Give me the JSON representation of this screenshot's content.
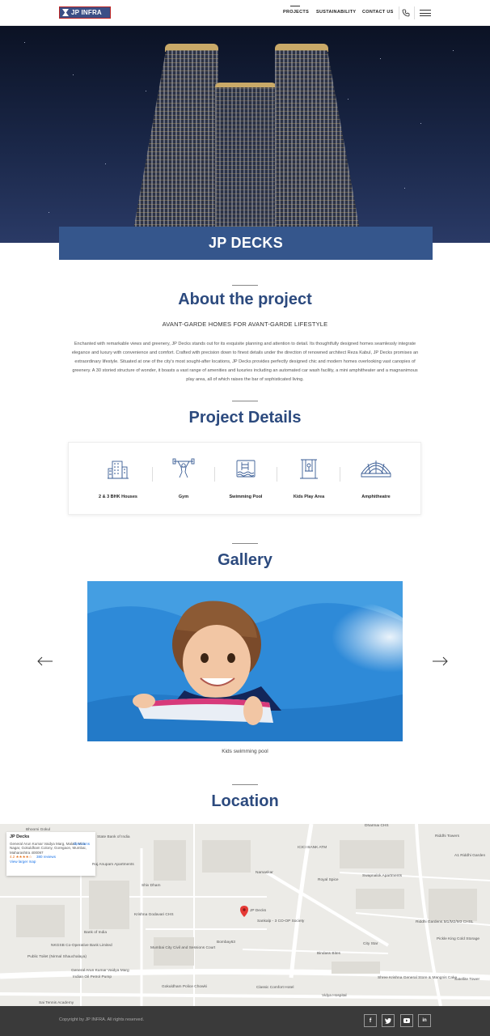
{
  "header": {
    "logo_text": "JP INFRA",
    "nav": [
      "PROJECTS",
      "SUSTAINABILITY",
      "CONTACT US"
    ]
  },
  "hero": {
    "title": "JP DECKS"
  },
  "about": {
    "heading": "About the project",
    "subheading": "AVANT-GARDE HOMES FOR AVANT-GARDE LIFESTYLE",
    "body": "Enchanted with remarkable views and greenery, JP Decks stands out for its exquisite planning and attention to detail. Its thoughtfully designed homes seamlessly integrate elegance and luxury with convenience and comfort. Crafted with precision down to finest details under the direction of renowned architect Reza Kabul, JP Decks promises an extraordinary lifestyle. Situated at one of the city's most sought-after locations, JP Decks provides perfectly designed chic and modern homes overlooking vast canopies of greenery. A 30 storied structure of wonder, it boasts a vast range of amenities and luxuries including an automated car wash facility, a mini amphitheater and a magnanimous play area, all of which raises the bar of sophisticated living."
  },
  "details": {
    "heading": "Project Details",
    "features": [
      {
        "label": "2 & 3 BHK Houses",
        "icon": "building-icon"
      },
      {
        "label": "Gym",
        "icon": "weightlifter-icon"
      },
      {
        "label": "Swimming Pool",
        "icon": "pool-icon"
      },
      {
        "label": "Kids Play Area",
        "icon": "swing-icon"
      },
      {
        "label": "Amphitheatre",
        "icon": "amphitheatre-icon"
      }
    ]
  },
  "gallery": {
    "heading": "Gallery",
    "caption": "Kids swimming pool"
  },
  "location": {
    "heading": "Location",
    "info": {
      "name": "JP Decks",
      "address": "General Arun Kumar Vaidya Marg, Malad, Mira Nagar, Gokuldham Colony, Goregaon, Mumbai, Maharashtra 400097",
      "rating": "4.2 ★★★★☆",
      "reviews": "380 reviews",
      "larger_map": "View larger map",
      "directions": "Directions"
    },
    "labels": [
      "Bhoomi Gokul",
      "State Bank of India",
      "ICICI BANK ATM",
      "Riddhi Towers",
      "Raj Anupam Apartments",
      "Namaskar",
      "Royal Spice",
      "Swapnalok Apartments",
      "A1 Riddhi Garden",
      "Shiv Dham",
      "JP Decks",
      "Sankalp - 3 CO-OP Society",
      "Krishna Godavari CHS",
      "Bank of India",
      "NKGSB Co-Operative Bank Limited",
      "Public Toilet (Nirmal Shauchalaya)",
      "Mumbai City Civil and Sessions Court",
      "Bombay63",
      "Riddhi Gardens M1/M2/M3 CHSL",
      "Pickle King Cold Storage",
      "City Star",
      "Bindass Bites",
      "Indian Oil Petrol Pump",
      "General Arun Kumar Vaidya Marg",
      "Gokuldham Police Chowki",
      "Classic Comfort Hotel",
      "Shree Krishna General Store & Mangnis Cake",
      "Vidya Hospital",
      "Satellite Tower",
      "Sai Tennis Academy",
      "Dharmai CHS"
    ]
  },
  "footer": {
    "copyright": "Copyright by JP INFRA. All rights reserved.",
    "social": [
      "f",
      "t",
      "yt",
      "in"
    ]
  }
}
